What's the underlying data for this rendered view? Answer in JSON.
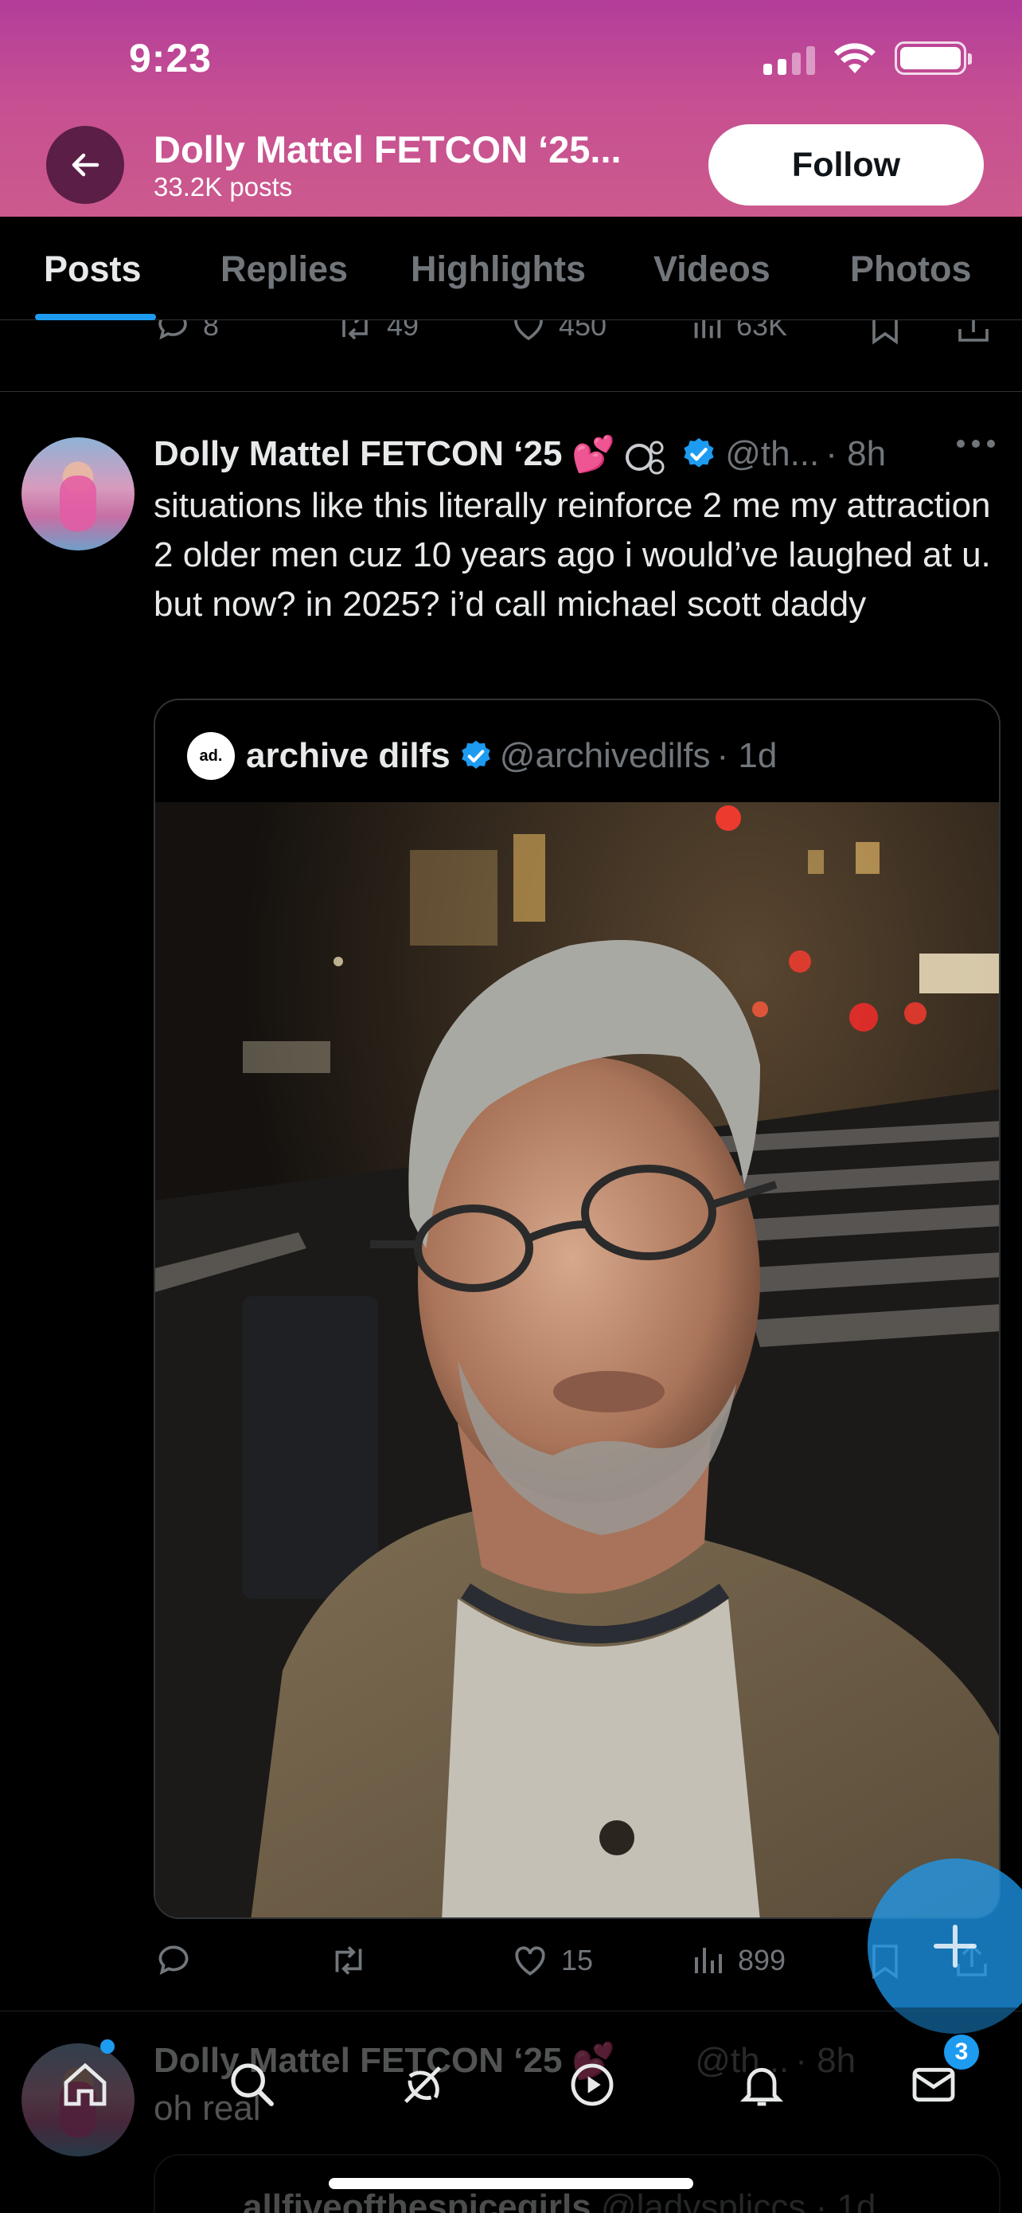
{
  "status_bar": {
    "time": "9:23"
  },
  "header": {
    "name": "Dolly Mattel FETCON ‘25...",
    "posts": "33.2K posts",
    "follow_label": "Follow"
  },
  "tabs": [
    {
      "label": "Posts",
      "active": true
    },
    {
      "label": "Replies"
    },
    {
      "label": "Highlights"
    },
    {
      "label": "Videos"
    },
    {
      "label": "Photos"
    }
  ],
  "previous_tweet_actions": {
    "replies": "8",
    "reposts": "49",
    "likes": "450",
    "views": "63K"
  },
  "tweet": {
    "name": "Dolly Mattel FETCON ‘25",
    "emoji": "💕",
    "handle": "@th...",
    "time": "· 8h",
    "text": "situations like this literally reinforce 2 me my attraction 2 older men cuz 10 years ago i would’ve laughed at u. but now? in 2025? i’d call michael scott daddy",
    "quote": {
      "avatar_text": "ad.",
      "name": "archive dilfs",
      "handle": "@archivedilfs",
      "time": "· 1d"
    },
    "actions": {
      "replies": "",
      "reposts": "",
      "likes": "15",
      "views": "899"
    }
  },
  "next_tweet": {
    "name": "Dolly Mattel FETCON ‘25",
    "emoji": "💕",
    "handle": "@th...",
    "time": "· 8h",
    "text": "oh real",
    "quote_name": "allfiveofthespicegirls",
    "quote_handle": "@ladyspliccs",
    "quote_time": "· 1d"
  },
  "bottom_nav": {
    "messages_badge": "3"
  },
  "colors": {
    "accent": "#1d9bf0",
    "verified": "#1d9bf0",
    "header_top": "#b23d9a",
    "header_bottom": "#cc5a8d"
  }
}
